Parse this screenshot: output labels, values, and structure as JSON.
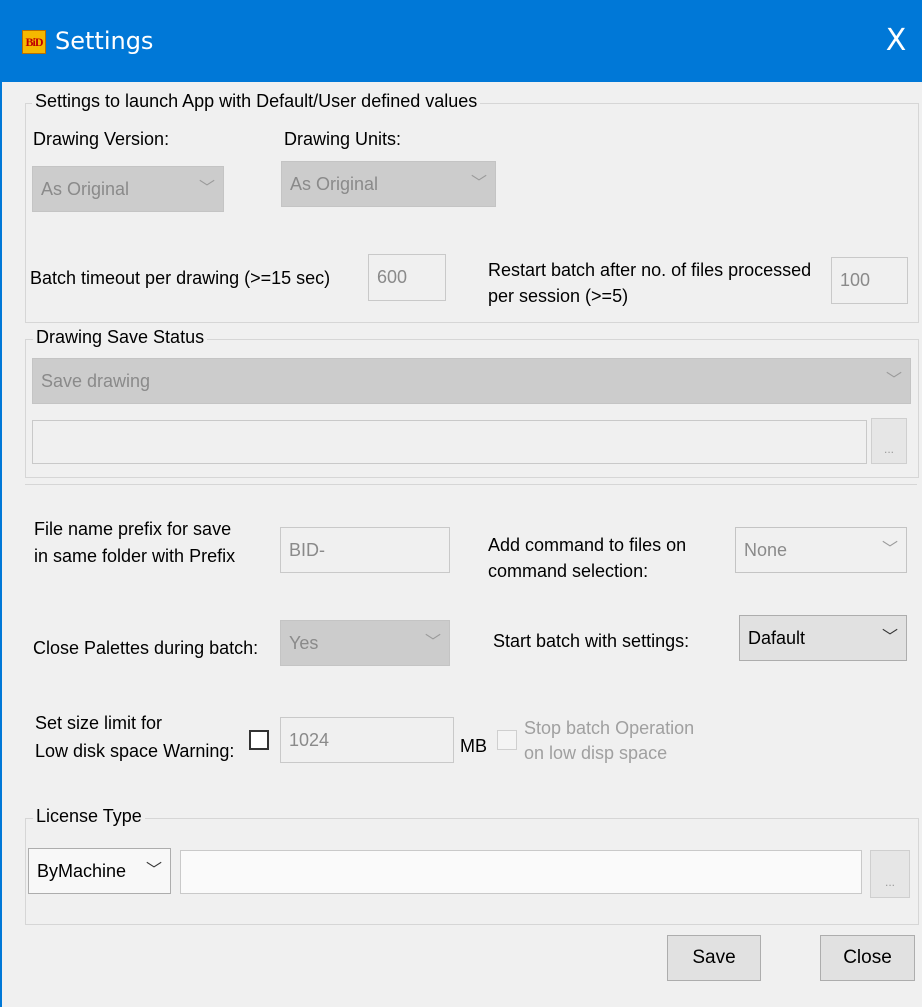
{
  "window": {
    "title": "Settings",
    "close_glyph": "X",
    "app_icon_text": "BiD"
  },
  "launch_group": {
    "legend": "Settings to launch App with Default/User defined values",
    "drawing_version": {
      "label": "Drawing Version:",
      "value": "As Original"
    },
    "drawing_units": {
      "label": "Drawing Units:",
      "value": "As Original"
    },
    "batch_timeout": {
      "label": "Batch timeout per drawing (>=15 sec)",
      "value": "600"
    },
    "restart_batch": {
      "label_line1": "Restart batch after no. of files processed",
      "label_line2": "per session (>=5)",
      "value": "100"
    }
  },
  "save_status": {
    "legend": "Drawing Save Status",
    "value": "Save drawing",
    "path": "",
    "browse_label": "..."
  },
  "options": {
    "prefix": {
      "label_line1": "File name prefix for save",
      "label_line2": "in same folder with Prefix",
      "value": "BID-"
    },
    "add_command": {
      "label_line1": "Add command to files on",
      "label_line2": "command selection:",
      "value": "None"
    },
    "close_palettes": {
      "label": "Close Palettes during batch:",
      "value": "Yes"
    },
    "start_batch": {
      "label": "Start batch with settings:",
      "value": "Dafault"
    },
    "size_limit": {
      "label_line1": "Set  size limit for",
      "label_line2": "Low disk space Warning:",
      "value": "1024",
      "unit": "MB",
      "checked": false
    },
    "stop_batch": {
      "label_line1": "Stop  batch  Operation",
      "label_line2": "on low disp space",
      "checked": false
    }
  },
  "license": {
    "legend": "License Type",
    "value": "ByMachine",
    "key": "",
    "browse_label": "..."
  },
  "footer": {
    "save_label": "Save",
    "close_label": "Close"
  },
  "icons": {
    "dropdown": "chevron-down-icon",
    "close": "close-icon"
  },
  "colors": {
    "titlebar": "#0078d7",
    "background": "#f0f0f0",
    "disabled_text": "#8a8a8a"
  }
}
